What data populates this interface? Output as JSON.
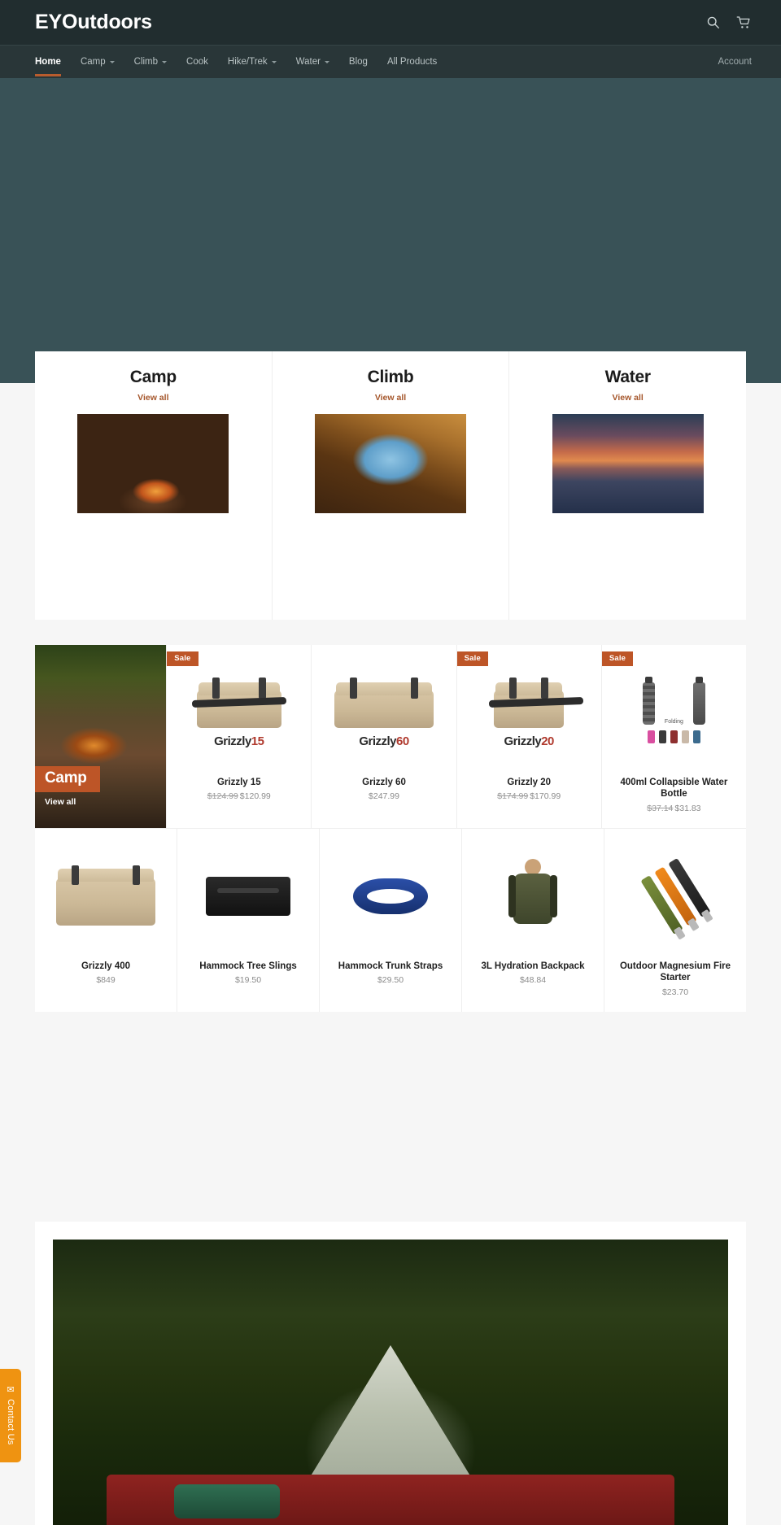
{
  "header": {
    "logo": "EYOutdoors",
    "search_icon": "search-icon",
    "cart_icon": "cart-icon"
  },
  "nav": {
    "items": [
      {
        "label": "Home",
        "has_caret": false,
        "active": true
      },
      {
        "label": "Camp",
        "has_caret": true,
        "active": false
      },
      {
        "label": "Climb",
        "has_caret": true,
        "active": false
      },
      {
        "label": "Cook",
        "has_caret": false,
        "active": false
      },
      {
        "label": "Hike/Trek",
        "has_caret": true,
        "active": false
      },
      {
        "label": "Water",
        "has_caret": true,
        "active": false
      },
      {
        "label": "Blog",
        "has_caret": false,
        "active": false
      },
      {
        "label": "All Products",
        "has_caret": false,
        "active": false
      }
    ],
    "account_label": "Account"
  },
  "collections": [
    {
      "title": "Camp",
      "view_all": "View all",
      "art": "img-camp"
    },
    {
      "title": "Climb",
      "view_all": "View all",
      "art": "img-climb"
    },
    {
      "title": "Water",
      "view_all": "View all",
      "art": "img-water"
    }
  ],
  "promo": {
    "label": "Camp",
    "view_all": "View all"
  },
  "products": {
    "sale_badge": "Sale",
    "row1": [
      {
        "title": "Grizzly 15",
        "price_old": "$124.99",
        "price_new": "$120.99",
        "on_sale": true,
        "wordmark": "Grizzly",
        "wordmark_num": "15"
      },
      {
        "title": "Grizzly 60",
        "price_old": "",
        "price_new": "$247.99",
        "on_sale": false,
        "wordmark": "Grizzly",
        "wordmark_num": "60"
      },
      {
        "title": "Grizzly 20",
        "price_old": "$174.99",
        "price_new": "$170.99",
        "on_sale": true,
        "wordmark": "Grizzly",
        "wordmark_num": "20"
      },
      {
        "title": "400ml Collapsible Water Bottle",
        "price_old": "$37.14",
        "price_new": "$31.83",
        "on_sale": true,
        "wordmark": "",
        "wordmark_num": ""
      }
    ],
    "row2": [
      {
        "title": "Grizzly 400",
        "price_old": "",
        "price_new": "$849",
        "on_sale": false
      },
      {
        "title": "Hammock Tree Slings",
        "price_old": "",
        "price_new": "$19.50",
        "on_sale": false
      },
      {
        "title": "Hammock Trunk Straps",
        "price_old": "",
        "price_new": "$29.50",
        "on_sale": false
      },
      {
        "title": "3L Hydration Backpack",
        "price_old": "",
        "price_new": "$48.84",
        "on_sale": false
      },
      {
        "title": "Outdoor Magnesium Fire Starter",
        "price_old": "",
        "price_new": "$23.70",
        "on_sale": false
      }
    ]
  },
  "bottle_labels": {
    "fold": "Folding"
  },
  "contact": {
    "label": "Contact Us",
    "icon": "envelope-icon"
  },
  "colors": {
    "header_bg": "#212d2f",
    "nav_bg": "#293638",
    "hero_bg": "#395257",
    "accent": "#bd5527",
    "sale_badge": "#bd5527",
    "link": "#a5562b",
    "contact_tab": "#ef9311",
    "page_bg": "#f6f6f6",
    "card_bg": "#ffffff"
  }
}
